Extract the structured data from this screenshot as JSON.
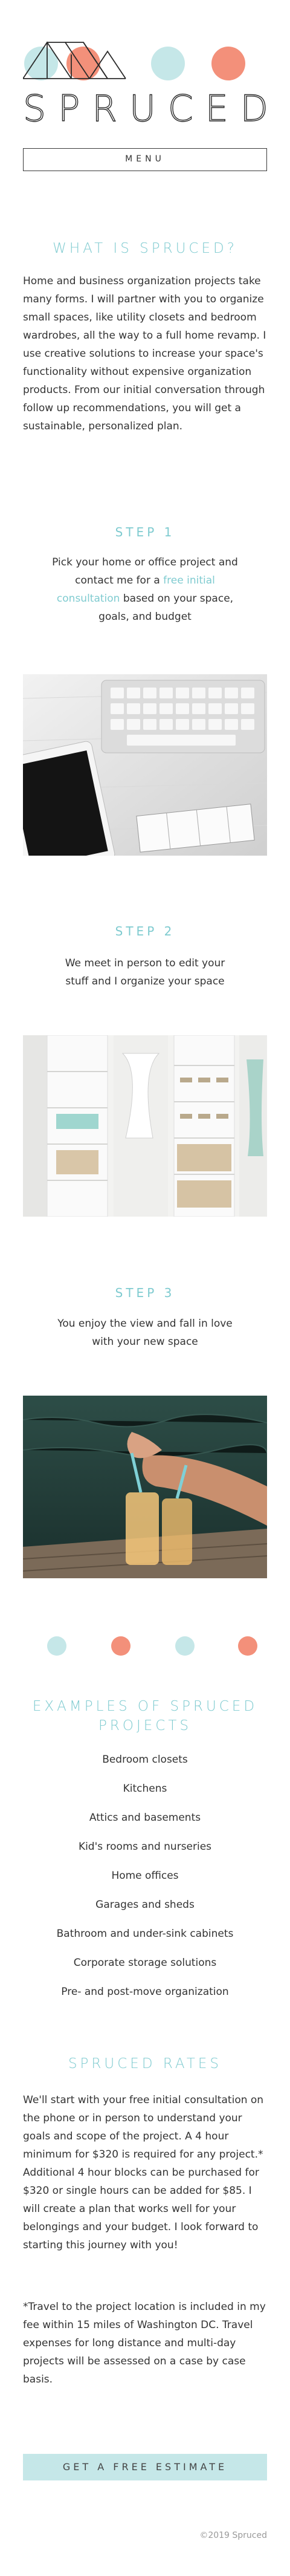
{
  "brand": {
    "name": "SPRUCED",
    "logo_icon": "house-roof-circles-logo"
  },
  "header": {
    "menu_label": "MENU"
  },
  "colors": {
    "teal": "#7fcbd0",
    "teal_light": "#c5e7e8",
    "coral": "#f3907a"
  },
  "about": {
    "title": "WHAT IS SPRUCED?",
    "text": "Home and business organization projects take many forms. I will partner with you to organize small spaces, like utility closets and bedroom wardrobes, all the way to a full home revamp. I use creative solutions to increase your space's functionality without expensive organization products. From our initial conversation through follow up recommendations, you will get a sustainable, personalized plan."
  },
  "steps": [
    {
      "title": "STEP 1",
      "text_before": "Pick your home or office project and contact me for a ",
      "link": "free initial consultation",
      "text_after": " based on your space, goals, and budget",
      "image": "desk-keyboard-tablet-calendar"
    },
    {
      "title": "STEP 2",
      "text": "We meet in person to edit your stuff and I organize your space",
      "image": "organized-white-closet"
    },
    {
      "title": "STEP 3",
      "text": "You enjoy the view and fall in love with your new space",
      "image": "feet-by-water-with-drinks"
    }
  ],
  "examples": {
    "title": "EXAMPLES OF SPRUCED PROJECTS",
    "items": [
      "Bedroom closets",
      "Kitchens",
      "Attics and basements",
      "Kid's rooms and nurseries",
      "Home offices",
      "Garages and sheds",
      "Bathroom and under-sink cabinets",
      "Corporate storage solutions",
      "Pre- and post-move organization"
    ]
  },
  "rates": {
    "title": "SPRUCED RATES",
    "text": "We'll start with your free initial consultation on the phone or in person to understand your goals and scope of the project. A 4 hour minimum for $320 is required for any project.* Additional 4 hour blocks can be purchased for $320 or single hours can be added for $85. I will create a plan that works well for your belongings and your budget. I look forward to starting this journey with you!",
    "note": "*Travel to the project location is included in my fee within 15 miles of Washington DC. Travel expenses for long distance and multi-day projects will be assessed on a case by case basis."
  },
  "cta": {
    "label": "GET A FREE ESTIMATE"
  },
  "footer": {
    "copyright": "©2019 Spruced"
  }
}
